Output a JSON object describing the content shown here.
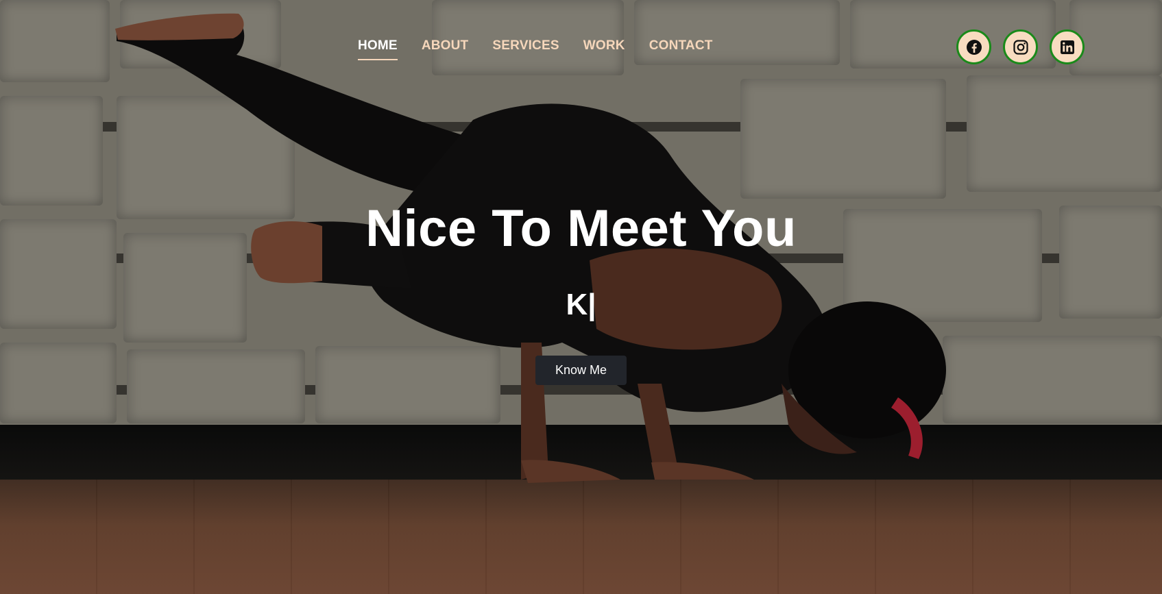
{
  "nav": {
    "items": [
      {
        "label": "HOME",
        "active": true
      },
      {
        "label": "ABOUT",
        "active": false
      },
      {
        "label": "SERVICES",
        "active": false
      },
      {
        "label": "WORK",
        "active": false
      },
      {
        "label": "CONTACT",
        "active": false
      }
    ]
  },
  "social": {
    "icons": [
      "facebook-icon",
      "instagram-icon",
      "linkedin-icon"
    ]
  },
  "hero": {
    "headline": "Nice To Meet You",
    "typed_text": "K|",
    "button_label": "Know Me"
  },
  "colors": {
    "nav_text": "#f6d7bb",
    "nav_active": "#ffffff",
    "social_bg": "#f8dcc0",
    "social_border": "#1a8a1a",
    "button_bg": "#22252b"
  }
}
